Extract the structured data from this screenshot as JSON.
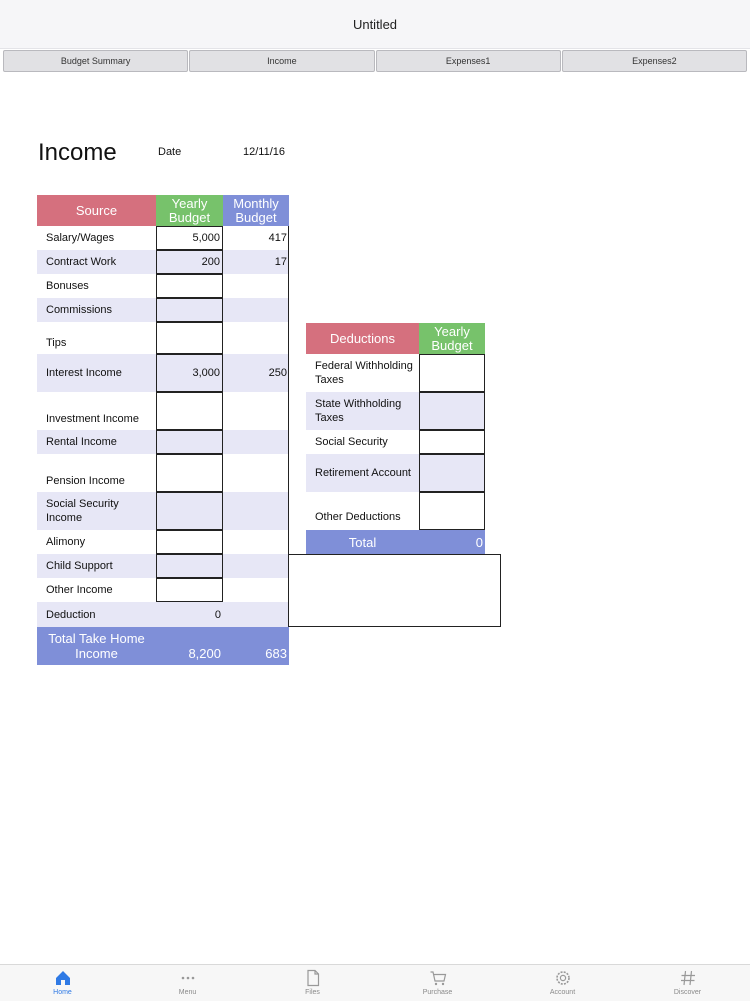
{
  "window": {
    "title": "Untitled"
  },
  "sheet_tabs": [
    "Budget Summary",
    "Income",
    "Expenses1",
    "Expenses2"
  ],
  "page": {
    "title": "Income",
    "date_label": "Date",
    "date_value": "12/11/16"
  },
  "income_table": {
    "headers": {
      "source": "Source",
      "yearly": "Yearly Budget",
      "monthly": "Monthly Budget"
    },
    "rows": [
      {
        "label": "Salary/Wages",
        "yearly": "5,000",
        "monthly": "417"
      },
      {
        "label": "Contract Work",
        "yearly": "200",
        "monthly": "17"
      },
      {
        "label": "Bonuses",
        "yearly": "",
        "monthly": ""
      },
      {
        "label": "Commissions",
        "yearly": "",
        "monthly": ""
      },
      {
        "label": "Tips",
        "yearly": "",
        "monthly": ""
      },
      {
        "label": "Interest Income",
        "yearly": "3,000",
        "monthly": "250"
      },
      {
        "label": "Investment Income",
        "yearly": "",
        "monthly": ""
      },
      {
        "label": "Rental Income",
        "yearly": "",
        "monthly": ""
      },
      {
        "label": "Pension Income",
        "yearly": "",
        "monthly": ""
      },
      {
        "label": "Social Security Income",
        "yearly": "",
        "monthly": ""
      },
      {
        "label": "Alimony",
        "yearly": "",
        "monthly": ""
      },
      {
        "label": "Child Support",
        "yearly": "",
        "monthly": ""
      },
      {
        "label": "Other Income",
        "yearly": "",
        "monthly": ""
      },
      {
        "label": "Deduction",
        "yearly": "0",
        "monthly": ""
      }
    ],
    "total": {
      "label": "Total Take Home Income",
      "yearly": "8,200",
      "monthly": "683"
    }
  },
  "deductions_table": {
    "headers": {
      "deductions": "Deductions",
      "yearly": "Yearly Budget"
    },
    "rows": [
      {
        "label": "Federal Withholding Taxes",
        "yearly": ""
      },
      {
        "label": "State Withholding Taxes",
        "yearly": ""
      },
      {
        "label": "Social Security",
        "yearly": ""
      },
      {
        "label": "Retirement Account",
        "yearly": ""
      },
      {
        "label": "Other Deductions",
        "yearly": ""
      }
    ],
    "total": {
      "label": "Total",
      "yearly": "0"
    }
  },
  "bottom_tabs": [
    {
      "label": "Home",
      "icon": "home-icon",
      "active": true
    },
    {
      "label": "Menu",
      "icon": "more-dots-icon",
      "active": false
    },
    {
      "label": "Files",
      "icon": "file-icon",
      "active": false
    },
    {
      "label": "Purchase",
      "icon": "cart-icon",
      "active": false
    },
    {
      "label": "Account",
      "icon": "gear-icon",
      "active": false
    },
    {
      "label": "Discover",
      "icon": "hashtag-icon",
      "active": false
    }
  ],
  "colors": {
    "pink_header": "#d5707e",
    "green_header": "#77c26b",
    "blue_header": "#7f8fd8",
    "row_shade": "#e7e7f6",
    "active_tab": "#2f7ae5"
  }
}
